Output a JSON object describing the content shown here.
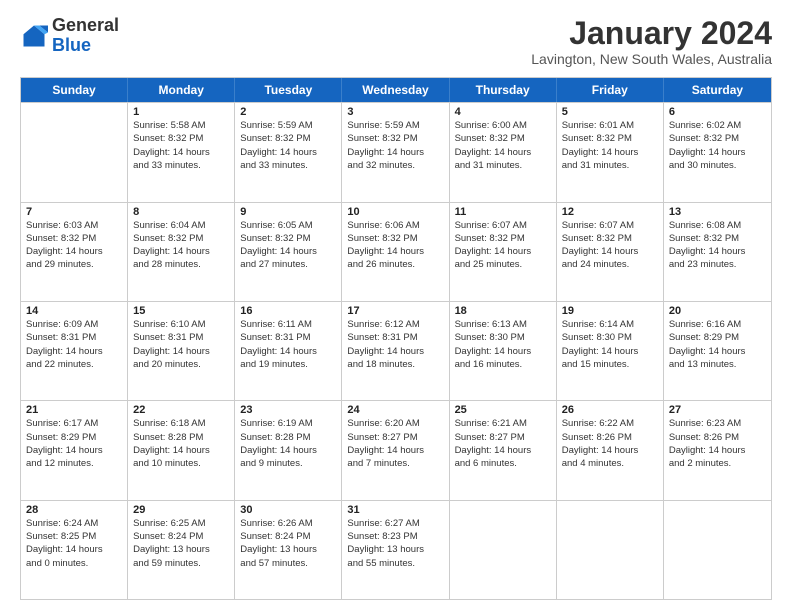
{
  "logo": {
    "general": "General",
    "blue": "Blue"
  },
  "header": {
    "month_title": "January 2024",
    "subtitle": "Lavington, New South Wales, Australia"
  },
  "days_of_week": [
    "Sunday",
    "Monday",
    "Tuesday",
    "Wednesday",
    "Thursday",
    "Friday",
    "Saturday"
  ],
  "weeks": [
    [
      {
        "day": "",
        "lines": []
      },
      {
        "day": "1",
        "lines": [
          "Sunrise: 5:58 AM",
          "Sunset: 8:32 PM",
          "Daylight: 14 hours",
          "and 33 minutes."
        ]
      },
      {
        "day": "2",
        "lines": [
          "Sunrise: 5:59 AM",
          "Sunset: 8:32 PM",
          "Daylight: 14 hours",
          "and 33 minutes."
        ]
      },
      {
        "day": "3",
        "lines": [
          "Sunrise: 5:59 AM",
          "Sunset: 8:32 PM",
          "Daylight: 14 hours",
          "and 32 minutes."
        ]
      },
      {
        "day": "4",
        "lines": [
          "Sunrise: 6:00 AM",
          "Sunset: 8:32 PM",
          "Daylight: 14 hours",
          "and 31 minutes."
        ]
      },
      {
        "day": "5",
        "lines": [
          "Sunrise: 6:01 AM",
          "Sunset: 8:32 PM",
          "Daylight: 14 hours",
          "and 31 minutes."
        ]
      },
      {
        "day": "6",
        "lines": [
          "Sunrise: 6:02 AM",
          "Sunset: 8:32 PM",
          "Daylight: 14 hours",
          "and 30 minutes."
        ]
      }
    ],
    [
      {
        "day": "7",
        "lines": [
          "Sunrise: 6:03 AM",
          "Sunset: 8:32 PM",
          "Daylight: 14 hours",
          "and 29 minutes."
        ]
      },
      {
        "day": "8",
        "lines": [
          "Sunrise: 6:04 AM",
          "Sunset: 8:32 PM",
          "Daylight: 14 hours",
          "and 28 minutes."
        ]
      },
      {
        "day": "9",
        "lines": [
          "Sunrise: 6:05 AM",
          "Sunset: 8:32 PM",
          "Daylight: 14 hours",
          "and 27 minutes."
        ]
      },
      {
        "day": "10",
        "lines": [
          "Sunrise: 6:06 AM",
          "Sunset: 8:32 PM",
          "Daylight: 14 hours",
          "and 26 minutes."
        ]
      },
      {
        "day": "11",
        "lines": [
          "Sunrise: 6:07 AM",
          "Sunset: 8:32 PM",
          "Daylight: 14 hours",
          "and 25 minutes."
        ]
      },
      {
        "day": "12",
        "lines": [
          "Sunrise: 6:07 AM",
          "Sunset: 8:32 PM",
          "Daylight: 14 hours",
          "and 24 minutes."
        ]
      },
      {
        "day": "13",
        "lines": [
          "Sunrise: 6:08 AM",
          "Sunset: 8:32 PM",
          "Daylight: 14 hours",
          "and 23 minutes."
        ]
      }
    ],
    [
      {
        "day": "14",
        "lines": [
          "Sunrise: 6:09 AM",
          "Sunset: 8:31 PM",
          "Daylight: 14 hours",
          "and 22 minutes."
        ]
      },
      {
        "day": "15",
        "lines": [
          "Sunrise: 6:10 AM",
          "Sunset: 8:31 PM",
          "Daylight: 14 hours",
          "and 20 minutes."
        ]
      },
      {
        "day": "16",
        "lines": [
          "Sunrise: 6:11 AM",
          "Sunset: 8:31 PM",
          "Daylight: 14 hours",
          "and 19 minutes."
        ]
      },
      {
        "day": "17",
        "lines": [
          "Sunrise: 6:12 AM",
          "Sunset: 8:31 PM",
          "Daylight: 14 hours",
          "and 18 minutes."
        ]
      },
      {
        "day": "18",
        "lines": [
          "Sunrise: 6:13 AM",
          "Sunset: 8:30 PM",
          "Daylight: 14 hours",
          "and 16 minutes."
        ]
      },
      {
        "day": "19",
        "lines": [
          "Sunrise: 6:14 AM",
          "Sunset: 8:30 PM",
          "Daylight: 14 hours",
          "and 15 minutes."
        ]
      },
      {
        "day": "20",
        "lines": [
          "Sunrise: 6:16 AM",
          "Sunset: 8:29 PM",
          "Daylight: 14 hours",
          "and 13 minutes."
        ]
      }
    ],
    [
      {
        "day": "21",
        "lines": [
          "Sunrise: 6:17 AM",
          "Sunset: 8:29 PM",
          "Daylight: 14 hours",
          "and 12 minutes."
        ]
      },
      {
        "day": "22",
        "lines": [
          "Sunrise: 6:18 AM",
          "Sunset: 8:28 PM",
          "Daylight: 14 hours",
          "and 10 minutes."
        ]
      },
      {
        "day": "23",
        "lines": [
          "Sunrise: 6:19 AM",
          "Sunset: 8:28 PM",
          "Daylight: 14 hours",
          "and 9 minutes."
        ]
      },
      {
        "day": "24",
        "lines": [
          "Sunrise: 6:20 AM",
          "Sunset: 8:27 PM",
          "Daylight: 14 hours",
          "and 7 minutes."
        ]
      },
      {
        "day": "25",
        "lines": [
          "Sunrise: 6:21 AM",
          "Sunset: 8:27 PM",
          "Daylight: 14 hours",
          "and 6 minutes."
        ]
      },
      {
        "day": "26",
        "lines": [
          "Sunrise: 6:22 AM",
          "Sunset: 8:26 PM",
          "Daylight: 14 hours",
          "and 4 minutes."
        ]
      },
      {
        "day": "27",
        "lines": [
          "Sunrise: 6:23 AM",
          "Sunset: 8:26 PM",
          "Daylight: 14 hours",
          "and 2 minutes."
        ]
      }
    ],
    [
      {
        "day": "28",
        "lines": [
          "Sunrise: 6:24 AM",
          "Sunset: 8:25 PM",
          "Daylight: 14 hours",
          "and 0 minutes."
        ]
      },
      {
        "day": "29",
        "lines": [
          "Sunrise: 6:25 AM",
          "Sunset: 8:24 PM",
          "Daylight: 13 hours",
          "and 59 minutes."
        ]
      },
      {
        "day": "30",
        "lines": [
          "Sunrise: 6:26 AM",
          "Sunset: 8:24 PM",
          "Daylight: 13 hours",
          "and 57 minutes."
        ]
      },
      {
        "day": "31",
        "lines": [
          "Sunrise: 6:27 AM",
          "Sunset: 8:23 PM",
          "Daylight: 13 hours",
          "and 55 minutes."
        ]
      },
      {
        "day": "",
        "lines": []
      },
      {
        "day": "",
        "lines": []
      },
      {
        "day": "",
        "lines": []
      }
    ]
  ]
}
